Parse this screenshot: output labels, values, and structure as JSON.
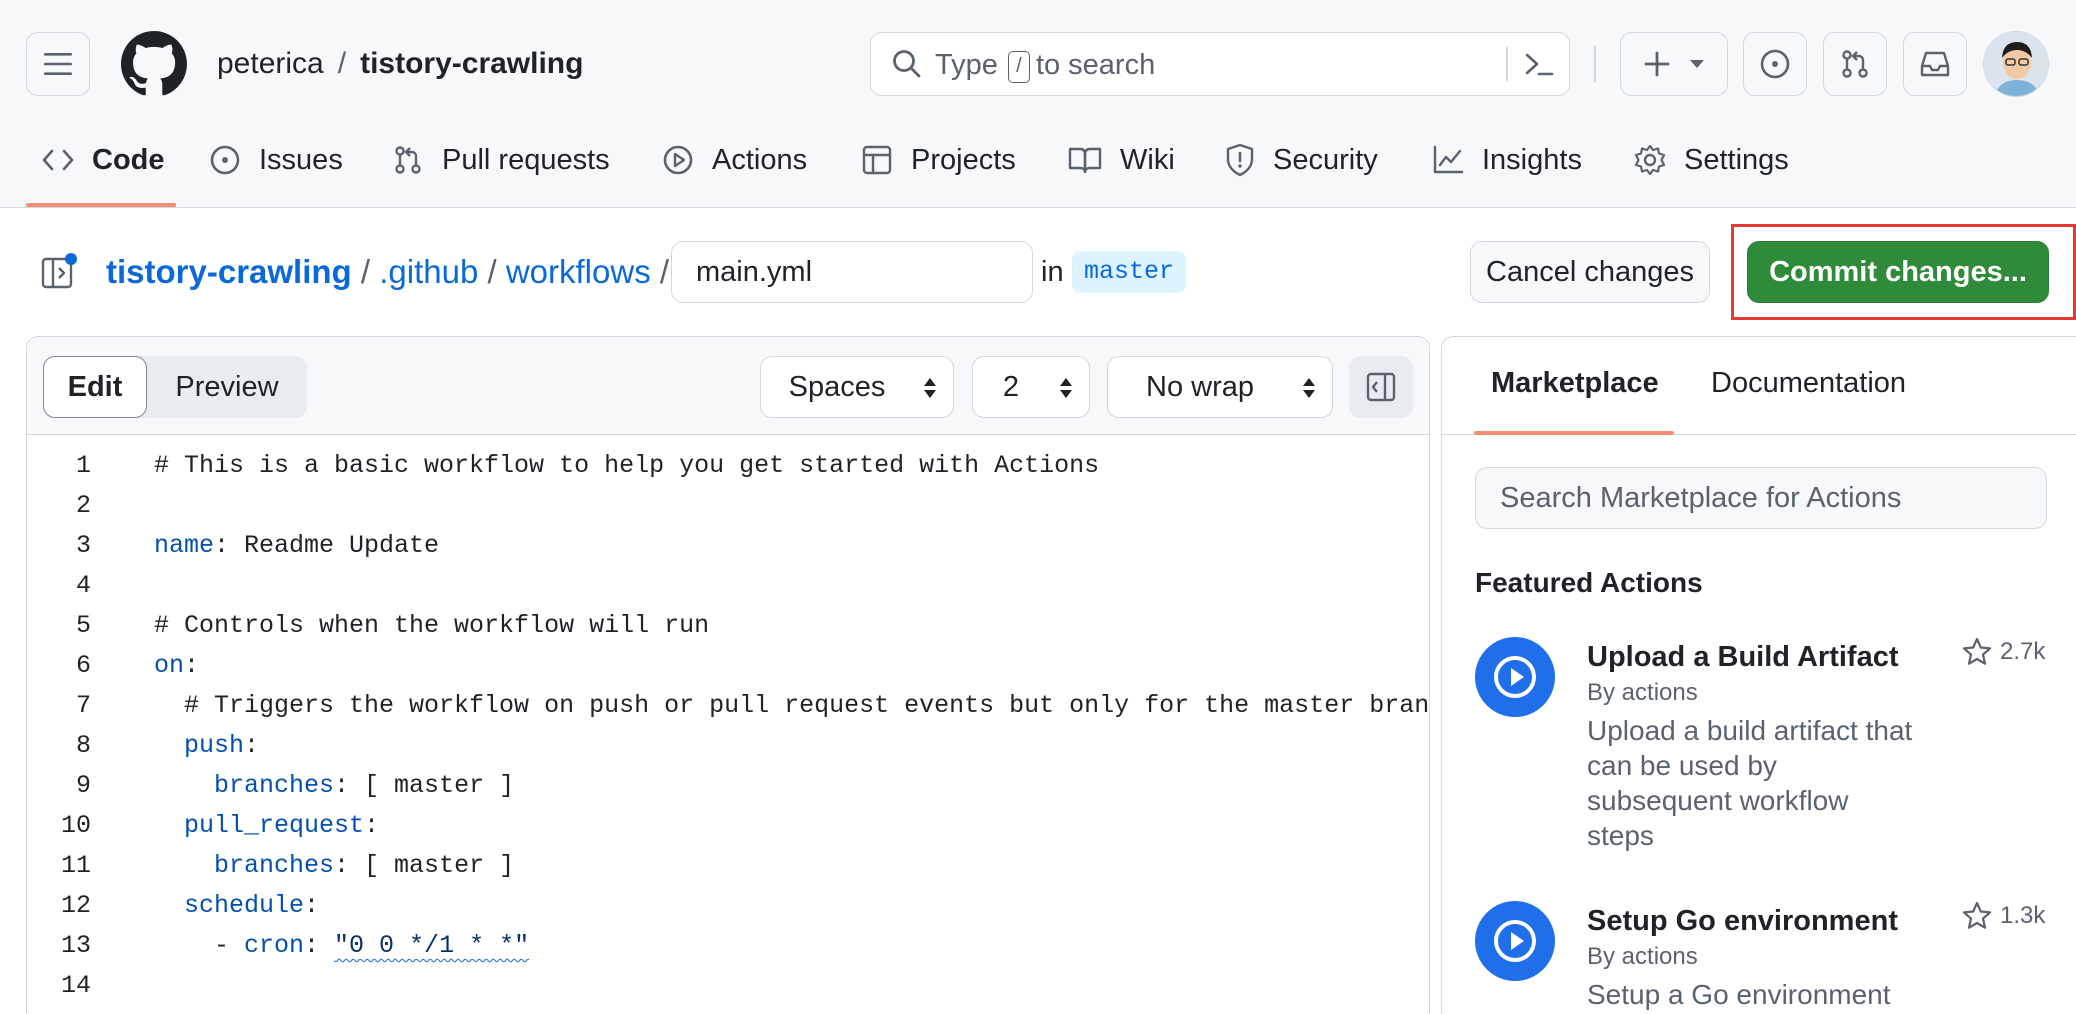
{
  "header": {
    "owner": "peterica",
    "separator": "/",
    "repo": "tistory-crawling",
    "search": {
      "before_key": "Type",
      "key": "/",
      "after_key": "to search"
    }
  },
  "repo_tabs": [
    {
      "label": "Code",
      "icon": "code-icon",
      "active": true
    },
    {
      "label": "Issues",
      "icon": "issue-icon"
    },
    {
      "label": "Pull requests",
      "icon": "pull-request-icon"
    },
    {
      "label": "Actions",
      "icon": "play-icon"
    },
    {
      "label": "Projects",
      "icon": "table-icon"
    },
    {
      "label": "Wiki",
      "icon": "book-icon"
    },
    {
      "label": "Security",
      "icon": "shield-icon"
    },
    {
      "label": "Insights",
      "icon": "graph-icon"
    },
    {
      "label": "Settings",
      "icon": "gear-icon"
    }
  ],
  "breadcrumb": {
    "root": "tistory-crawling",
    "dir1": ".github",
    "dir2": "workflows",
    "slash": "/",
    "filename": "main.yml",
    "in_label": "in",
    "branch": "master"
  },
  "actions": {
    "cancel": "Cancel changes",
    "commit": "Commit changes...",
    "highlight_color": "#e53935"
  },
  "editor": {
    "mode_edit": "Edit",
    "mode_preview": "Preview",
    "indent_mode": "Spaces",
    "indent_size": "2",
    "wrap_mode": "No wrap",
    "lines": [
      {
        "n": "1",
        "parts": [
          {
            "t": "# This is a basic workflow to help you get started with Actions"
          }
        ]
      },
      {
        "n": "2",
        "parts": []
      },
      {
        "n": "3",
        "parts": [
          {
            "t": "name",
            "c": "kw"
          },
          {
            "t": ": Readme Update"
          }
        ]
      },
      {
        "n": "4",
        "parts": []
      },
      {
        "n": "5",
        "parts": [
          {
            "t": "# Controls when the workflow will run"
          }
        ]
      },
      {
        "n": "6",
        "parts": [
          {
            "t": "on",
            "c": "kw"
          },
          {
            "t": ":"
          }
        ]
      },
      {
        "n": "7",
        "parts": [
          {
            "t": "  # Triggers the workflow on push or pull request events but only for the master branch"
          }
        ]
      },
      {
        "n": "8",
        "parts": [
          {
            "t": "  "
          },
          {
            "t": "push",
            "c": "kw"
          },
          {
            "t": ":"
          }
        ]
      },
      {
        "n": "9",
        "parts": [
          {
            "t": "    "
          },
          {
            "t": "branches",
            "c": "kw"
          },
          {
            "t": ": [ master ]"
          }
        ]
      },
      {
        "n": "10",
        "parts": [
          {
            "t": "  "
          },
          {
            "t": "pull_request",
            "c": "kw"
          },
          {
            "t": ":"
          }
        ]
      },
      {
        "n": "11",
        "parts": [
          {
            "t": "    "
          },
          {
            "t": "branches",
            "c": "kw"
          },
          {
            "t": ": [ master ]"
          }
        ]
      },
      {
        "n": "12",
        "parts": [
          {
            "t": "  "
          },
          {
            "t": "schedule",
            "c": "kw"
          },
          {
            "t": ":"
          }
        ]
      },
      {
        "n": "13",
        "parts": [
          {
            "t": "    - "
          },
          {
            "t": "cron",
            "c": "kw"
          },
          {
            "t": ": "
          },
          {
            "t": "\"0 0 */1 * *\"",
            "c": "str"
          }
        ]
      },
      {
        "n": "14",
        "parts": []
      }
    ]
  },
  "side_panel": {
    "tab_marketplace": "Marketplace",
    "tab_documentation": "Documentation",
    "search_placeholder": "Search Marketplace for Actions",
    "featured_title": "Featured Actions",
    "items": [
      {
        "title": "Upload a Build Artifact",
        "by": "By actions",
        "desc": "Upload a build artifact that can be used by subsequent workflow steps",
        "stars": "2.7k"
      },
      {
        "title": "Setup Go environment",
        "by": "By actions",
        "desc": "Setup a Go environment",
        "stars": "1.3k"
      }
    ]
  },
  "colors": {
    "link": "#0969da",
    "commit_button": "#2f8a3a",
    "tab_underline": "#fd8c73",
    "action_icon": "#1f6feb"
  }
}
